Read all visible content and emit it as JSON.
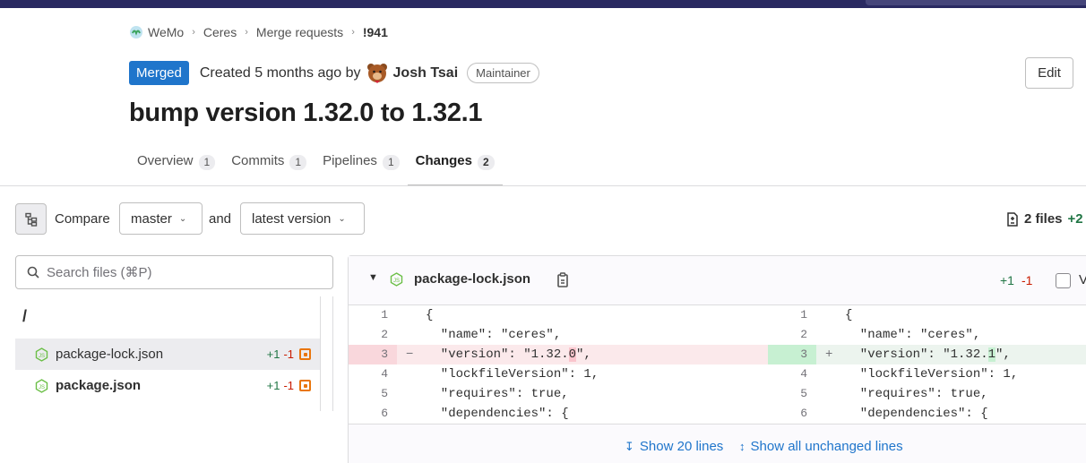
{
  "breadcrumb": {
    "items": [
      "WeMo",
      "Ceres",
      "Merge requests",
      "!941"
    ]
  },
  "header": {
    "status_badge": "Merged",
    "created_text": "Created 5 months ago by",
    "author": "Josh Tsai",
    "role": "Maintainer",
    "edit_label": "Edit"
  },
  "title": "bump version 1.32.0 to 1.32.1",
  "tabs": [
    {
      "label": "Overview",
      "count": "1"
    },
    {
      "label": "Commits",
      "count": "1"
    },
    {
      "label": "Pipelines",
      "count": "1"
    },
    {
      "label": "Changes",
      "count": "2"
    }
  ],
  "toolbar": {
    "compare_label": "Compare",
    "base_branch": "master",
    "and_label": "and",
    "target_version": "latest version",
    "files_changed": "2 files",
    "additions": "+2"
  },
  "file_search": {
    "placeholder": "Search files (⌘P)"
  },
  "file_tree": {
    "root": "/",
    "files": [
      {
        "name": "package-lock.json",
        "add": "+1",
        "del": "-1"
      },
      {
        "name": "package.json",
        "add": "+1",
        "del": "-1"
      }
    ]
  },
  "diff": {
    "filename": "package-lock.json",
    "add": "+1",
    "del": "-1",
    "viewed_label": "V",
    "lines": [
      {
        "old_no": "1",
        "new_no": "1",
        "old": "{",
        "new": "{"
      },
      {
        "old_no": "2",
        "new_no": "2",
        "old": "  \"name\": \"ceres\",",
        "new": "  \"name\": \"ceres\","
      },
      {
        "old_no": "3",
        "new_no": "3",
        "old_pre": "  \"version\": \"1.32.",
        "old_hl": "0",
        "old_post": "\",",
        "new_pre": "  \"version\": \"1.32.",
        "new_hl": "1",
        "new_post": "\",",
        "del_marker": "−",
        "add_marker": "+"
      },
      {
        "old_no": "4",
        "new_no": "4",
        "old": "  \"lockfileVersion\": 1,",
        "new": "  \"lockfileVersion\": 1,"
      },
      {
        "old_no": "5",
        "new_no": "5",
        "old": "  \"requires\": true,",
        "new": "  \"requires\": true,"
      },
      {
        "old_no": "6",
        "new_no": "6",
        "old": "  \"dependencies\": {",
        "new": "  \"dependencies\": {"
      }
    ],
    "show_lines_label": "Show 20 lines",
    "show_all_label": "Show all unchanged lines"
  },
  "colors": {
    "merged": "#1f75cb",
    "addition": "#217645",
    "deletion": "#c91c00",
    "topbar": "#292961"
  }
}
